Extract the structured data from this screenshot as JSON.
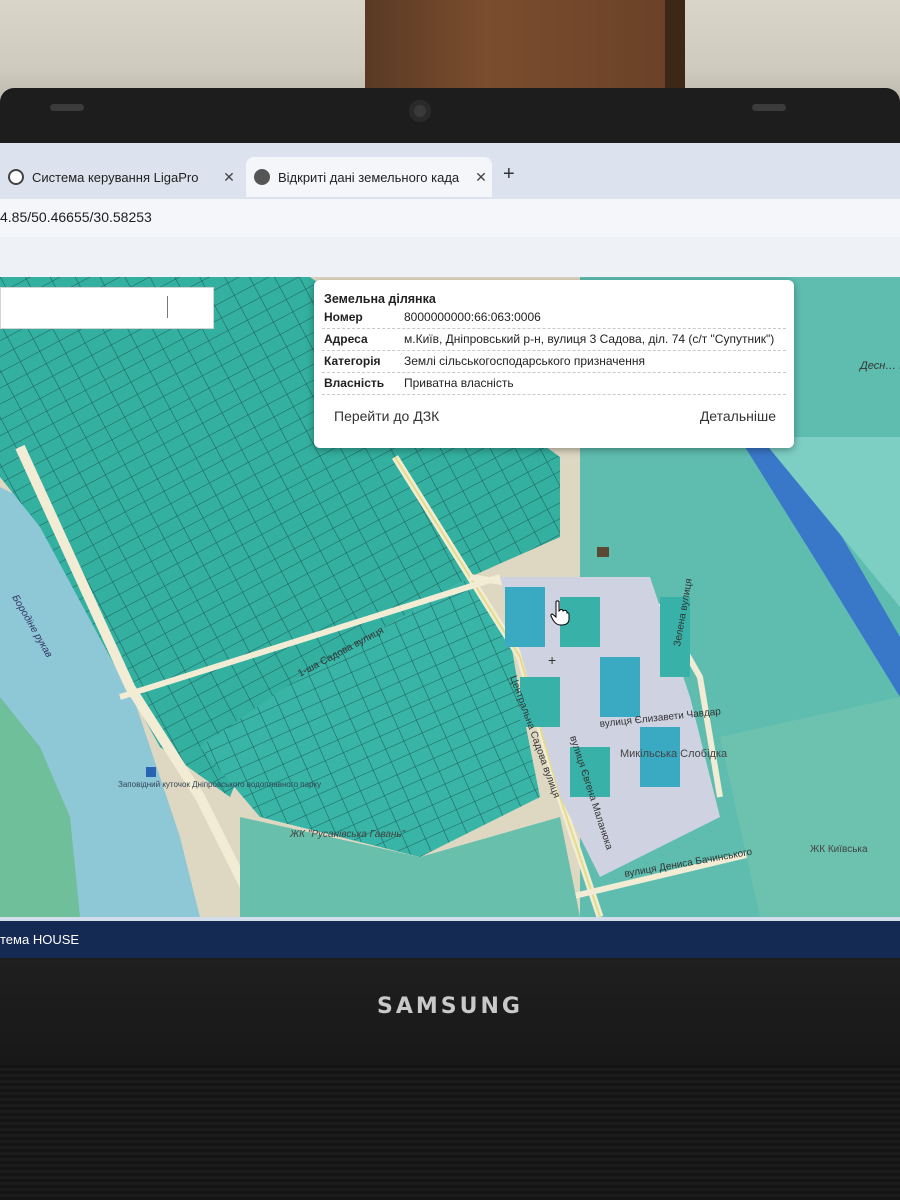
{
  "browser": {
    "tabs": [
      {
        "title": "Система керування LigaPro",
        "favicon": "ligapro-icon",
        "close": "✕"
      },
      {
        "title": "Відкриті дані земельного када",
        "favicon": "cadastre-globe-icon",
        "close": "✕"
      }
    ],
    "new_tab": "+",
    "address": "4.85/50.46655/30.58253"
  },
  "parcel_popup": {
    "title": "Земельна ділянка",
    "rows": [
      {
        "label": "Номер",
        "value": "8000000000:66:063:0006"
      },
      {
        "label": "Адреса",
        "value": "м.Київ, Дніпровський р-н, вулиця 3 Садова, діл. 74 (с/т \"Супутник\")"
      },
      {
        "label": "Категорія",
        "value": "Землі сільськогосподарського призначення"
      },
      {
        "label": "Власність",
        "value": "Приватна власність"
      }
    ],
    "goto_link": "Перейти до ДЗК",
    "details_link": "Детальніше"
  },
  "map_labels": {
    "desna_station": "Десн… водоп… ста…",
    "street_1_sadova": "1-ша Садова вулиця",
    "street_central": "Центральна Садова вулиця",
    "street_zelena": "Зелена вулиця",
    "street_elizaveta": "вулиця Єлизавети Чавдар",
    "street_tykhonova": "вулиця Євгена Маланюка",
    "street_denysa": "вулиця Дениса Бачинського",
    "district_slobidka": "Микільська Слобідка",
    "complex": "ЖК \"Русанівська Гавань\"",
    "complex2": "ЖК Київська",
    "river_label": "Бородіне рукав",
    "museum": "Заповідний куточок Дніпровського водоплавного парку"
  },
  "taskbar": {
    "label": "тема HOUSE"
  },
  "brand": "SAMSUNG",
  "colors": {
    "parcel": "#33b0a0",
    "parcel_dark": "#207a73",
    "water": "#8ec8d6",
    "accent_tab": "#2b6cd9",
    "taskbar": "#152a52"
  }
}
